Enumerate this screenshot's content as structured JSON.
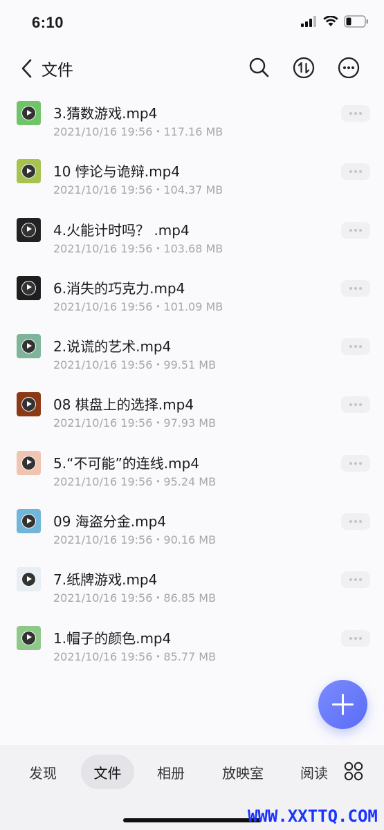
{
  "status_bar": {
    "time": "6:10"
  },
  "nav": {
    "title": "文件",
    "icons": [
      "back-icon",
      "search-icon",
      "sort-icon",
      "more-icon"
    ]
  },
  "files": [
    {
      "name": "3.猜数游戏.mp4",
      "meta": "2021/10/16 19:56・117.16 MB",
      "thumb_bg": "#6fc46a"
    },
    {
      "name": "10 悖论与诡辩.mp4",
      "meta": "2021/10/16 19:56・104.37 MB",
      "thumb_bg": "#a7c24f"
    },
    {
      "name": "4.火能计时吗？ .mp4",
      "meta": "2021/10/16 19:56・103.68 MB",
      "thumb_bg": "#222222"
    },
    {
      "name": "6.消失的巧克力.mp4",
      "meta": "2021/10/16 19:56・101.09 MB",
      "thumb_bg": "#1e1e1e"
    },
    {
      "name": "2.说谎的艺术.mp4",
      "meta": "2021/10/16 19:56・99.51 MB",
      "thumb_bg": "#7db49a"
    },
    {
      "name": "08 棋盘上的选择.mp4",
      "meta": "2021/10/16 19:56・97.93 MB",
      "thumb_bg": "#8a3a16"
    },
    {
      "name": "5.“不可能”的连线.mp4",
      "meta": "2021/10/16 19:56・95.24 MB",
      "thumb_bg": "#f0c4b0"
    },
    {
      "name": "09 海盗分金.mp4",
      "meta": "2021/10/16 19:56・90.16 MB",
      "thumb_bg": "#6fb6d8"
    },
    {
      "name": "7.纸牌游戏.mp4",
      "meta": "2021/10/16 19:56・86.85 MB",
      "thumb_bg": "#e8eef4"
    },
    {
      "name": "1.帽子的颜色.mp4",
      "meta": "2021/10/16 19:56・85.77 MB",
      "thumb_bg": "#8fc98a"
    }
  ],
  "tabs": [
    {
      "label": "发现"
    },
    {
      "label": "文件",
      "active": true
    },
    {
      "label": "相册"
    },
    {
      "label": "放映室"
    },
    {
      "label": "阅读"
    }
  ],
  "watermark": "WWW.XXTTQ.COM",
  "colors": {
    "accent": "#5a6df5",
    "meta_text": "#a6a6ab"
  }
}
